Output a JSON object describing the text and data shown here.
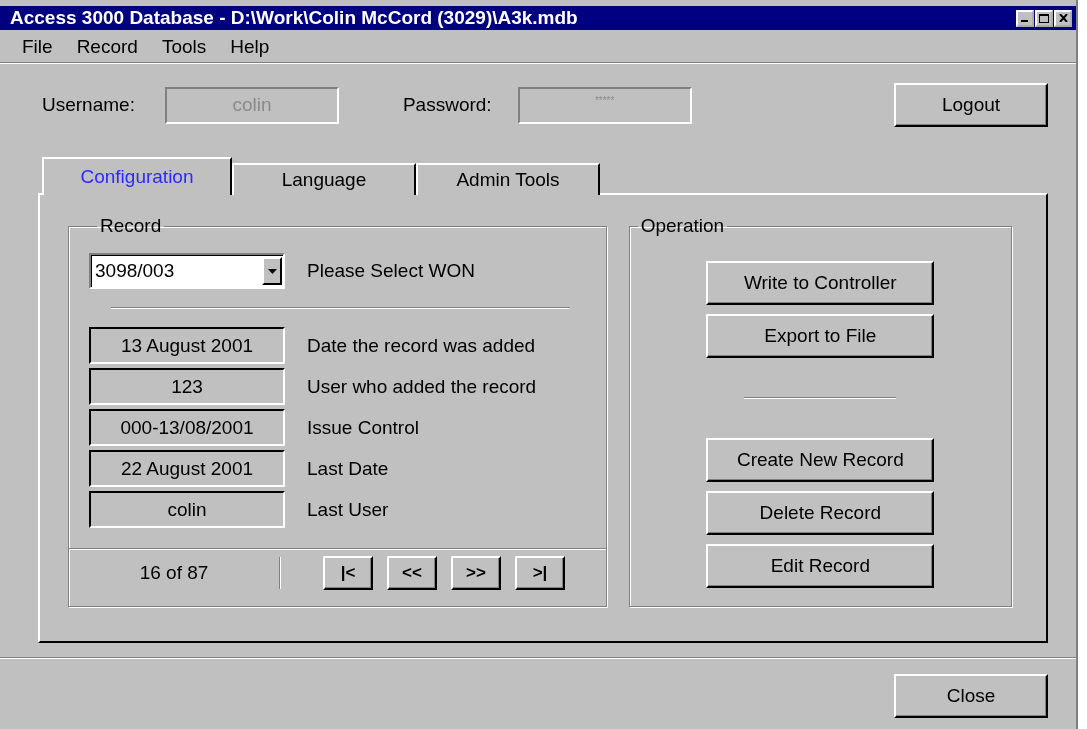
{
  "window": {
    "title": "Access 3000 Database - D:\\Work\\Colin McCord (3029)\\A3k.mdb"
  },
  "menu": [
    {
      "label": "File"
    },
    {
      "label": "Record"
    },
    {
      "label": "Tools"
    },
    {
      "label": "Help"
    }
  ],
  "login": {
    "username_label": "Username:",
    "username": "colin",
    "username_disabled": true,
    "password_label": "Password:",
    "password": "*****",
    "logout": "Logout"
  },
  "tabs": [
    {
      "label": "Configuration",
      "selected": true
    },
    {
      "label": "Language",
      "selected": false
    },
    {
      "label": "Admin Tools",
      "selected": false
    }
  ],
  "record": {
    "title": "Record",
    "won": {
      "value": "3098/003",
      "label": "Please Select WON"
    },
    "fields": [
      {
        "value": "13 August 2001",
        "label": "Date the record was added"
      },
      {
        "value": "123",
        "label": "User who added the record"
      },
      {
        "value": "000-13/08/2001",
        "label": "Issue Control"
      },
      {
        "value": "22 August 2001",
        "label": "Last Date"
      },
      {
        "value": "colin",
        "label": "Last User"
      }
    ],
    "position": "16 of 87",
    "nav": [
      "|<",
      "<<",
      ">>",
      ">|"
    ]
  },
  "operation": {
    "title": "Operation",
    "buttons_top": [
      {
        "label": "Write to Controller"
      },
      {
        "label": "Export to File"
      }
    ],
    "buttons_bottom": [
      {
        "label": "Create New Record"
      },
      {
        "label": "Delete Record"
      },
      {
        "label": "Edit Record"
      }
    ]
  },
  "close": {
    "label": "Close"
  }
}
